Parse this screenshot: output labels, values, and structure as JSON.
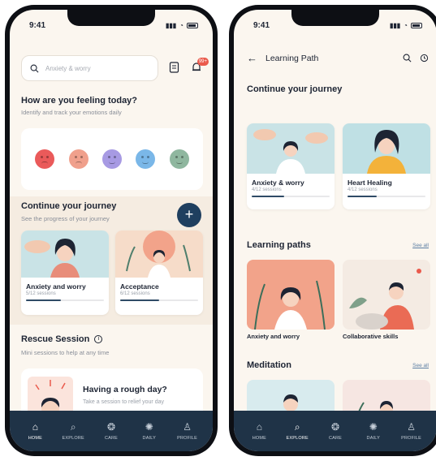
{
  "status": {
    "time": "9:41"
  },
  "home": {
    "search": {
      "placeholder": "Anxiety & worry"
    },
    "notif_badge": "99+",
    "feeling_title": "How are you feeling today?",
    "feeling_sub": "Identify and track your emotions daily",
    "moods": [
      {
        "name": "angry",
        "color": "#ea5a5a"
      },
      {
        "name": "sad",
        "color": "#f0a08c"
      },
      {
        "name": "neutral",
        "color": "#a79ae3"
      },
      {
        "name": "calm",
        "color": "#7ab7e8"
      },
      {
        "name": "content",
        "color": "#8fb79f"
      }
    ],
    "journey_title": "Continue your journey",
    "journey_sub": "See the progress of your journey",
    "journey_cards": [
      {
        "title": "Anxiety and worry",
        "meta": "5/12 sessions",
        "progress": 0.45
      },
      {
        "title": "Acceptance",
        "meta": "6/12 sessions",
        "progress": 0.5
      }
    ],
    "rescue_title": "Rescue Session",
    "rescue_sub": "Mini sessions to help at any time",
    "rough_title": "Having a rough day?",
    "rough_sub": "Take a session to relief your day"
  },
  "nav_left": [
    {
      "label": "HOME",
      "icon": "home-icon"
    },
    {
      "label": "EXPLORE",
      "icon": "search-icon"
    },
    {
      "label": "CARE",
      "icon": "care-icon"
    },
    {
      "label": "DAILY",
      "icon": "daily-icon"
    },
    {
      "label": "PROFILE",
      "icon": "profile-icon"
    }
  ],
  "learning": {
    "header_title": "Learning Path",
    "journey_title": "Continue your journey",
    "journey_cards": [
      {
        "title": "Anxiety & worry",
        "meta": "4/12 sessions",
        "progress": 0.42
      },
      {
        "title": "Heart Healing",
        "meta": "4/12 sessions",
        "progress": 0.38
      }
    ],
    "paths_title": "Learning paths",
    "see_all": "See all",
    "paths": [
      {
        "label": "Anxiety and worry"
      },
      {
        "label": "Collaborative skills"
      }
    ],
    "meditation_title": "Meditation"
  },
  "nav_right": [
    {
      "label": "HOME",
      "icon": "home-icon"
    },
    {
      "label": "EXPLORE",
      "icon": "search-icon"
    },
    {
      "label": "CARE",
      "icon": "care-icon"
    },
    {
      "label": "DAILY",
      "icon": "daily-icon"
    },
    {
      "label": "PROFILE",
      "icon": "profile-icon"
    }
  ]
}
